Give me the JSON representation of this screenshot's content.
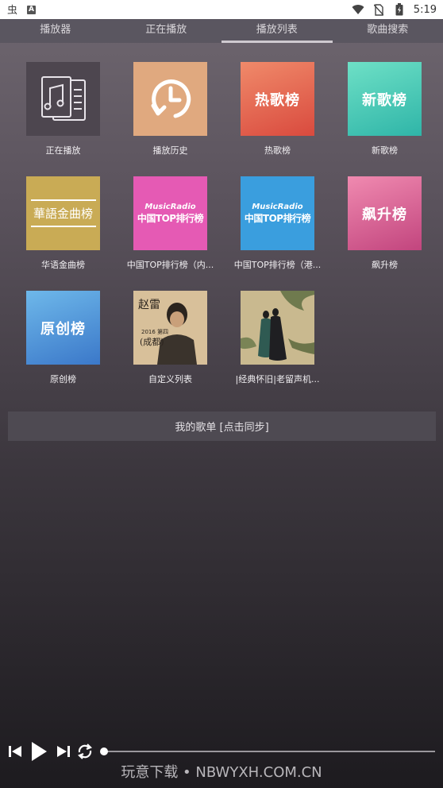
{
  "status_bar": {
    "time": "5:19",
    "icons": [
      "chinese-char-icon",
      "a-icon",
      "wifi-icon",
      "no-sim-icon",
      "battery-icon"
    ]
  },
  "tabs": [
    {
      "label": "播放器",
      "active": false
    },
    {
      "label": "正在播放",
      "active": false
    },
    {
      "label": "播放列表",
      "active": true
    },
    {
      "label": "歌曲搜索",
      "active": false
    }
  ],
  "playlists": [
    {
      "label": "正在播放",
      "thumb_text": ""
    },
    {
      "label": "播放历史",
      "thumb_text": ""
    },
    {
      "label": "热歌榜",
      "thumb_text": "热歌榜"
    },
    {
      "label": "新歌榜",
      "thumb_text": "新歌榜"
    },
    {
      "label": "华语金曲榜",
      "thumb_text": "華語金曲榜"
    },
    {
      "label": "中国TOP排行榜（内...",
      "thumb_l1": "MusicRadio",
      "thumb_l2": "中国TOP排行榜"
    },
    {
      "label": "中国TOP排行榜（港...",
      "thumb_l1": "MusicRadio",
      "thumb_l2": "中国TOP排行榜"
    },
    {
      "label": "飙升榜",
      "thumb_text": "飙升榜"
    },
    {
      "label": "原创榜",
      "thumb_text": "原创榜"
    },
    {
      "label": "自定义列表",
      "thumb_text": ""
    },
    {
      "label": "|经典怀旧|老留声机...",
      "thumb_text": ""
    }
  ],
  "custom_thumb": {
    "line1": "赵雷",
    "line2": "2016 第四",
    "line3": "(成都)"
  },
  "my_playlist": {
    "label": "我的歌单 [点击同步]"
  },
  "player": {
    "progress": 0
  },
  "watermark": "玩意下载 • NBWYXH.COM.CN"
}
